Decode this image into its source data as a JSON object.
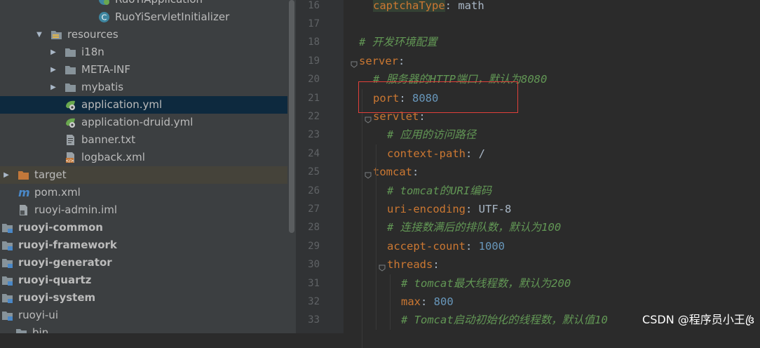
{
  "project_tree": {
    "items": [
      {
        "label": "RuoYiApplication",
        "icon": "spring-boot-class-icon",
        "state": "normal"
      },
      {
        "label": "RuoYiServletInitializer",
        "icon": "class-icon",
        "state": "normal"
      },
      {
        "label": "resources",
        "icon": "resources-folder-icon",
        "state": "expanded"
      },
      {
        "label": "i18n",
        "icon": "folder-icon",
        "state": "collapsed"
      },
      {
        "label": "META-INF",
        "icon": "folder-icon",
        "state": "collapsed"
      },
      {
        "label": "mybatis",
        "icon": "folder-icon",
        "state": "collapsed"
      },
      {
        "label": "application.yml",
        "icon": "spring-yaml-icon",
        "state": "selected"
      },
      {
        "label": "application-druid.yml",
        "icon": "spring-yaml-icon",
        "state": "normal"
      },
      {
        "label": "banner.txt",
        "icon": "text-file-icon",
        "state": "normal"
      },
      {
        "label": "logback.xml",
        "icon": "xml-file-icon",
        "state": "normal"
      },
      {
        "label": "target",
        "icon": "excluded-folder-icon",
        "state": "collapsed"
      },
      {
        "label": "pom.xml",
        "icon": "maven-icon",
        "state": "normal"
      },
      {
        "label": "ruoyi-admin.iml",
        "icon": "iml-file-icon",
        "state": "normal"
      },
      {
        "label": "ruoyi-common",
        "icon": "module-folder-icon",
        "state": "module"
      },
      {
        "label": "ruoyi-framework",
        "icon": "module-folder-icon",
        "state": "module"
      },
      {
        "label": "ruoyi-generator",
        "icon": "module-folder-icon",
        "state": "module"
      },
      {
        "label": "ruoyi-quartz",
        "icon": "module-folder-icon",
        "state": "module"
      },
      {
        "label": "ruoyi-system",
        "icon": "module-folder-icon",
        "state": "module"
      },
      {
        "label": "ruoyi-ui",
        "icon": "module-folder-icon",
        "state": "normal"
      },
      {
        "label": "bin",
        "icon": "folder-icon",
        "state": "normal"
      }
    ]
  },
  "editor": {
    "lines": [
      {
        "number": "16",
        "segments": [
          {
            "t": "captchaType",
            "c": "keyhl"
          },
          {
            "t": ": ",
            "c": "val"
          },
          {
            "t": "math",
            "c": "val"
          }
        ]
      },
      {
        "number": "17",
        "segments": []
      },
      {
        "number": "18",
        "segments": [
          {
            "t": "# 开发环境配置",
            "c": "cm"
          }
        ]
      },
      {
        "number": "19",
        "segments": [
          {
            "t": "server",
            "c": "key"
          },
          {
            "t": ":",
            "c": "val"
          }
        ]
      },
      {
        "number": "20",
        "segments": [
          {
            "t": "# 服务器的HTTP端口，默认为8080",
            "c": "cm"
          }
        ]
      },
      {
        "number": "21",
        "segments": [
          {
            "t": "port",
            "c": "key"
          },
          {
            "t": ": ",
            "c": "val"
          },
          {
            "t": "8080",
            "c": "num"
          }
        ]
      },
      {
        "number": "22",
        "segments": [
          {
            "t": "servlet",
            "c": "key"
          },
          {
            "t": ":",
            "c": "val"
          }
        ]
      },
      {
        "number": "23",
        "segments": [
          {
            "t": "# 应用的访问路径",
            "c": "cm"
          }
        ]
      },
      {
        "number": "24",
        "segments": [
          {
            "t": "context-path",
            "c": "key"
          },
          {
            "t": ": ",
            "c": "val"
          },
          {
            "t": "/",
            "c": "val"
          }
        ]
      },
      {
        "number": "25",
        "segments": [
          {
            "t": "tomcat",
            "c": "key"
          },
          {
            "t": ":",
            "c": "val"
          }
        ]
      },
      {
        "number": "26",
        "segments": [
          {
            "t": "# tomcat的URI编码",
            "c": "cm"
          }
        ]
      },
      {
        "number": "27",
        "segments": [
          {
            "t": "uri-encoding",
            "c": "key"
          },
          {
            "t": ": ",
            "c": "val"
          },
          {
            "t": "UTF-8",
            "c": "val"
          }
        ]
      },
      {
        "number": "28",
        "segments": [
          {
            "t": "# 连接数满后的排队数，默认为100",
            "c": "cm"
          }
        ]
      },
      {
        "number": "29",
        "segments": [
          {
            "t": "accept-count",
            "c": "key"
          },
          {
            "t": ": ",
            "c": "val"
          },
          {
            "t": "1000",
            "c": "num"
          }
        ]
      },
      {
        "number": "30",
        "segments": [
          {
            "t": "threads",
            "c": "key"
          },
          {
            "t": ":",
            "c": "val"
          }
        ]
      },
      {
        "number": "31",
        "segments": [
          {
            "t": "# tomcat最大线程数，默认为200",
            "c": "cm"
          }
        ]
      },
      {
        "number": "32",
        "segments": [
          {
            "t": "max",
            "c": "key"
          },
          {
            "t": ": ",
            "c": "val"
          },
          {
            "t": "800",
            "c": "num"
          }
        ]
      },
      {
        "number": "33",
        "segments": [
          {
            "t": "# Tomcat启动初始化的线程数，默认值10",
            "c": "cm"
          }
        ]
      }
    ]
  },
  "watermark": "CSDN @程序员小王꧔ꦿ",
  "colors": {
    "keyword": "#cc7832",
    "number": "#6897bb",
    "comment": "#629755",
    "highlight_box": "#e0403a",
    "selection": "#0d293e"
  }
}
